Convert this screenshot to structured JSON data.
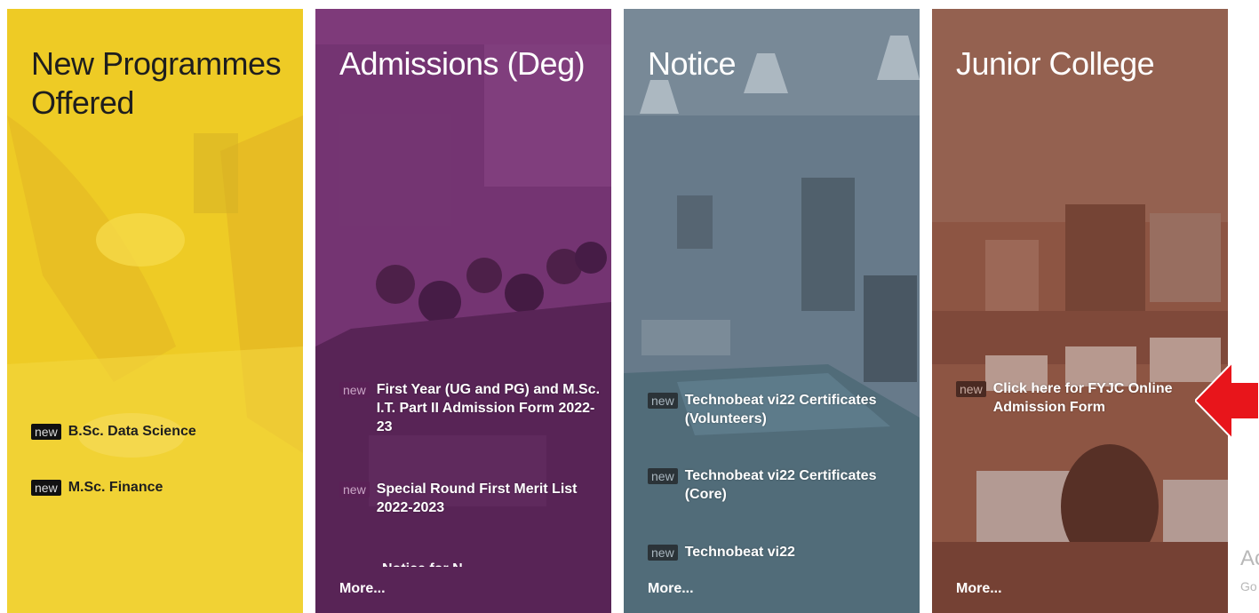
{
  "cards": [
    {
      "title": "New Programmes Offered",
      "items": [
        {
          "badge": "new",
          "text": "B.Sc. Data Science"
        },
        {
          "badge": "new",
          "text": "M.Sc. Finance"
        }
      ]
    },
    {
      "title": "Admissions (Deg)",
      "items": [
        {
          "badge": "new",
          "text": "First Year (UG and PG) and M.Sc. I.T. Part II Admission Form 2022-23"
        },
        {
          "badge": "new",
          "text": "Special Round First Merit List 2022-2023"
        }
      ],
      "partial_item": "Notice for N...",
      "more": "More..."
    },
    {
      "title": "Notice",
      "items": [
        {
          "badge": "new",
          "text": "Technobeat vi22 Certificates (Volunteers)"
        },
        {
          "badge": "new",
          "text": "Technobeat vi22 Certificates (Core)"
        },
        {
          "badge": "new",
          "text": "Technobeat vi22"
        }
      ],
      "more": "More..."
    },
    {
      "title": "Junior College",
      "items": [
        {
          "badge": "new",
          "text": "Click here for FYJC Online Admission Form"
        }
      ],
      "more": "More..."
    }
  ],
  "side_text": {
    "line1": "Ac",
    "line2": "Go"
  },
  "colors": {
    "yellow_overlay": "#f5d21f",
    "purple_overlay": "#6b2e68",
    "slate_overlay": "#5d6f80",
    "brown_overlay": "#8a5040",
    "arrow": "#e8151b"
  }
}
